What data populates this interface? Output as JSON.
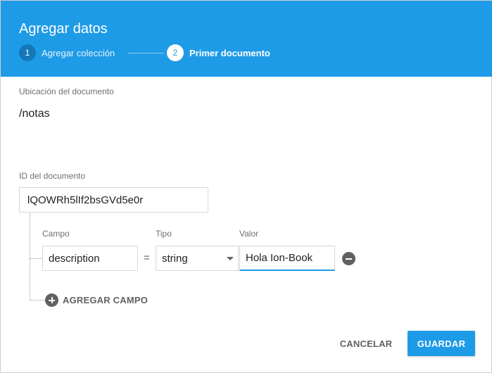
{
  "dialog": {
    "title": "Agregar datos"
  },
  "stepper": {
    "steps": [
      {
        "number": "1",
        "label": "Agregar colección"
      },
      {
        "number": "2",
        "label": "Primer documento"
      }
    ]
  },
  "location": {
    "label": "Ubicación del documento",
    "path": "/notas"
  },
  "document_id": {
    "label": "ID del documento",
    "value": "lQOWRh5lIf2bsGVd5e0r"
  },
  "fields_table": {
    "headers": {
      "field": "Campo",
      "type": "Tipo",
      "value": "Valor"
    },
    "rows": [
      {
        "field": "description",
        "equals": "=",
        "type": "string",
        "value": "Hola Ion-Book"
      }
    ]
  },
  "add_field": {
    "label": "AGREGAR CAMPO"
  },
  "actions": {
    "cancel": "CANCELAR",
    "save": "GUARDAR"
  },
  "colors": {
    "accent": "#1e9be6",
    "step_active_bg": "#1577b8"
  }
}
